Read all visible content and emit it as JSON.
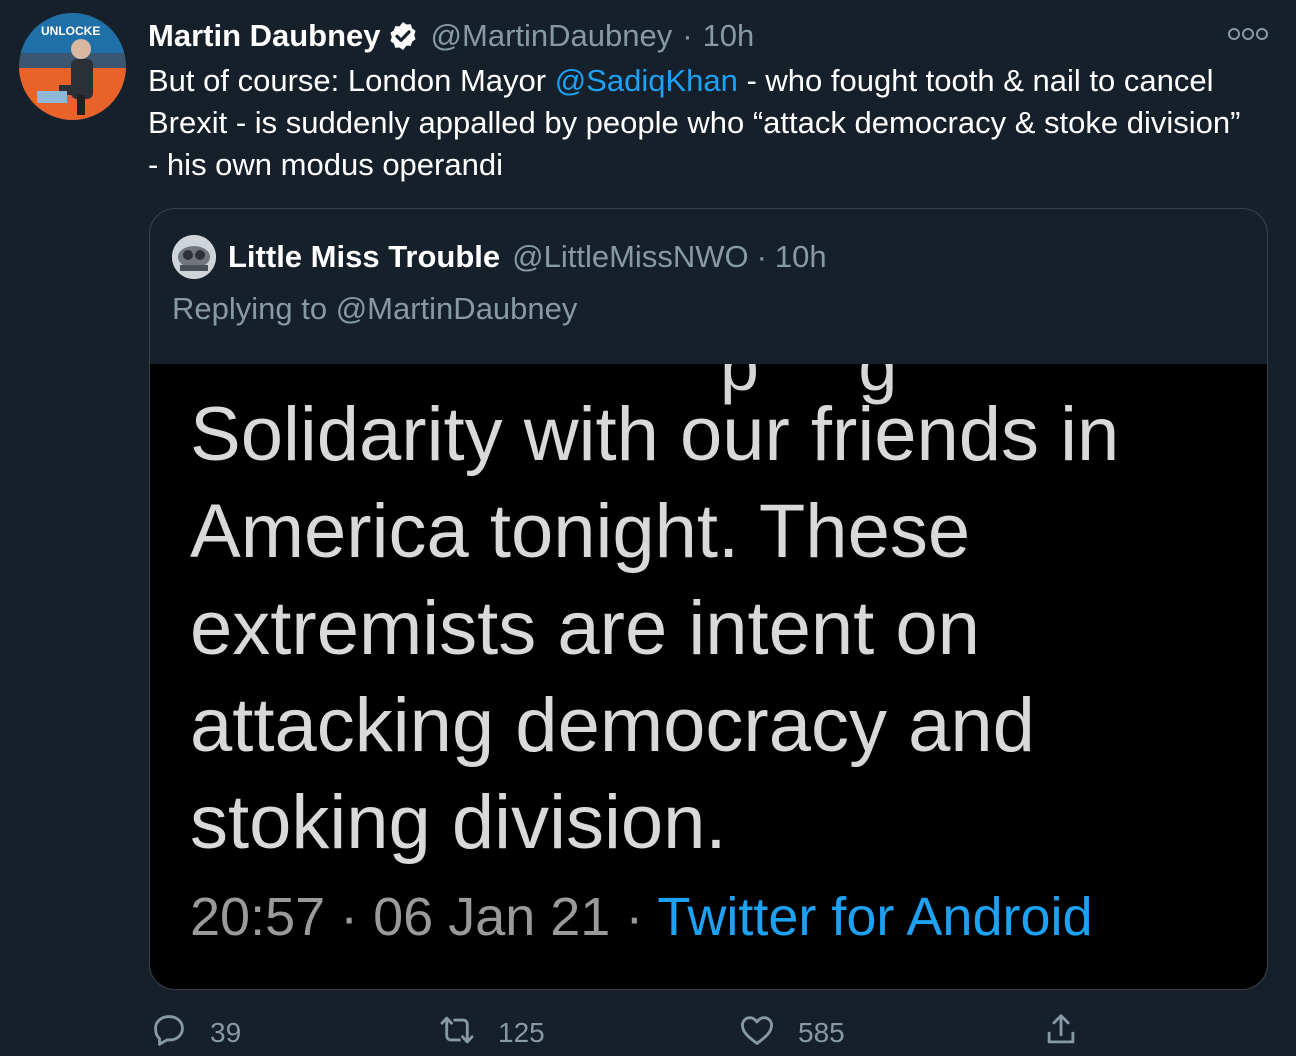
{
  "tweet": {
    "display_name": "Martin Daubney",
    "handle": "@MartinDaubney",
    "separator": "·",
    "time": "10h",
    "text_before": "But of course: London Mayor ",
    "mention": "@SadiqKhan",
    "text_after": " - who fought tooth & nail to cancel Brexit - is suddenly appalled by people who “attack democracy & stoke division” - his own modus operandi",
    "avatar_sign_text": "UNLOCKE"
  },
  "quoted": {
    "display_name": "Little Miss Trouble",
    "handle": "@LittleMissNWO",
    "separator": "·",
    "time": "10h",
    "replying_to": "Replying to @MartinDaubney",
    "image": {
      "text": "Solidarity with our friends in America tonight. These extremists are intent on attacking democracy and stoking division.",
      "timestamp": "20:57 · 06 Jan 21 · ",
      "source": "Twitter for Android"
    }
  },
  "actions": {
    "reply_count": "39",
    "retweet_count": "125",
    "like_count": "585"
  },
  "icons": [
    "verified-badge-icon",
    "more-icon",
    "reply-icon",
    "retweet-icon",
    "like-icon",
    "share-icon"
  ],
  "colors": {
    "background": "#15202b",
    "accent": "#1da1f2",
    "secondary_text": "#8899a6",
    "border": "#38444d"
  }
}
